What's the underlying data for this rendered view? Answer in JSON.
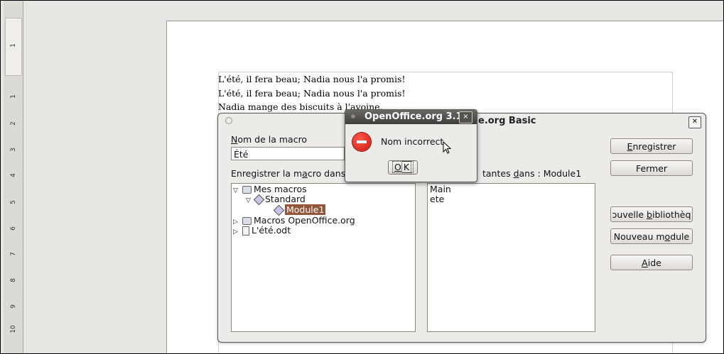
{
  "document": {
    "lines": [
      "L'été, il fera beau; Nadia nous l'a promis!",
      "L'été, il fera beau; Nadia nous l'a promis!",
      "Nadia mange des biscuits à l'avoine."
    ]
  },
  "ruler": {
    "numbers": [
      "1",
      "1",
      "2",
      "3",
      "4",
      "5",
      "6",
      "7",
      "8",
      "9",
      "10"
    ]
  },
  "macro_dialog": {
    "title": "e.org Basic",
    "name_label_prefix": "",
    "name_label_accel": "N",
    "name_label_rest": "om de la macro",
    "name_value": "Été",
    "save_in_label_a": "Enregistrer la m",
    "save_in_label_accel": "a",
    "save_in_label_b": "cro dans",
    "existing_label_a": "tantes ",
    "existing_label_accel": "d",
    "existing_label_b": "ans : Module1",
    "tree": {
      "mes_macros": "Mes macros",
      "standard": "Standard",
      "module1": "Module1",
      "macros_oo": "Macros OpenOffice.org",
      "doc": "L'été.odt"
    },
    "macros_list": [
      "Main",
      "ete"
    ],
    "buttons": {
      "save_accel": "E",
      "save_rest": "nregistrer",
      "close": "Fermer",
      "new_lib_a": "ɔuvelle ",
      "new_lib_accel": "b",
      "new_lib_b": "ibliothèq",
      "new_module_a": "Nouveau m",
      "new_module_accel": "o",
      "new_module_b": "dule",
      "help_accel": "A",
      "help_rest": "ide"
    }
  },
  "error_dialog": {
    "title": "OpenOffice.org 3.1",
    "message": "Nom incorrect",
    "ok_accel": "O",
    "ok_rest": "K",
    "close_glyph": "×"
  },
  "icons": {
    "error": "error-stop-icon",
    "close": "close-icon"
  },
  "colors": {
    "selection": "#93563a",
    "error_red": "#c6170c"
  }
}
